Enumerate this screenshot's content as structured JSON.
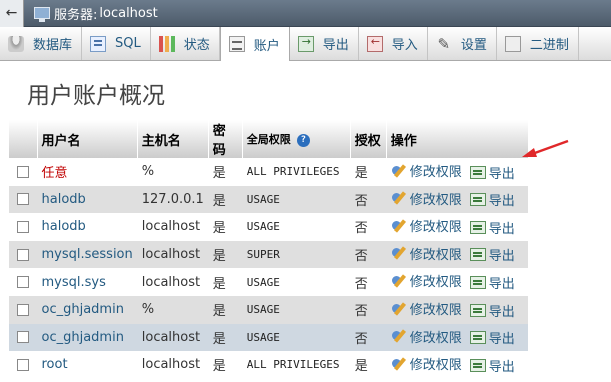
{
  "topbar": {
    "back_label": "←",
    "server_label": "服务器:",
    "server_name": "localhost"
  },
  "tabs": [
    {
      "label": "数据库",
      "icon": "database-icon"
    },
    {
      "label": "SQL",
      "icon": "sql-icon"
    },
    {
      "label": "状态",
      "icon": "status-icon"
    },
    {
      "label": "账户",
      "icon": "accounts-icon",
      "active": true
    },
    {
      "label": "导出",
      "icon": "export-icon"
    },
    {
      "label": "导入",
      "icon": "import-icon"
    },
    {
      "label": "设置",
      "icon": "settings-icon"
    },
    {
      "label": "二进制",
      "icon": "replication-icon"
    }
  ],
  "page_title": "用户账户概况",
  "table": {
    "headers": {
      "user": "用户名",
      "host": "主机名",
      "password": "密码",
      "global_privileges": "全局权限",
      "help": "?",
      "grant": "授权",
      "action": "操作"
    },
    "rows": [
      {
        "user": "任意",
        "host": "%",
        "password": "是",
        "privileges": "ALL PRIVILEGES",
        "grant": "是",
        "edit": "修改权限",
        "export": "导出"
      },
      {
        "user": "halodb",
        "host": "127.0.0.1",
        "password": "是",
        "privileges": "USAGE",
        "grant": "否",
        "edit": "修改权限",
        "export": "导出"
      },
      {
        "user": "halodb",
        "host": "localhost",
        "password": "是",
        "privileges": "USAGE",
        "grant": "否",
        "edit": "修改权限",
        "export": "导出"
      },
      {
        "user": "mysql.session",
        "host": "localhost",
        "password": "是",
        "privileges": "SUPER",
        "grant": "否",
        "edit": "修改权限",
        "export": "导出"
      },
      {
        "user": "mysql.sys",
        "host": "localhost",
        "password": "是",
        "privileges": "USAGE",
        "grant": "否",
        "edit": "修改权限",
        "export": "导出"
      },
      {
        "user": "oc_ghjadmin",
        "host": "%",
        "password": "是",
        "privileges": "USAGE",
        "grant": "否",
        "edit": "修改权限",
        "export": "导出"
      },
      {
        "user": "oc_ghjadmin",
        "host": "localhost",
        "password": "是",
        "privileges": "USAGE",
        "grant": "否",
        "edit": "修改权限",
        "export": "导出"
      },
      {
        "user": "root",
        "host": "localhost",
        "password": "是",
        "privileges": "ALL PRIVILEGES",
        "grant": "是",
        "edit": "修改权限",
        "export": "导出"
      }
    ]
  },
  "colors": {
    "link": "#235a81",
    "any_user": "#c00000",
    "arrow": "#e0282a",
    "row_highlight": "#cfd8e1"
  }
}
